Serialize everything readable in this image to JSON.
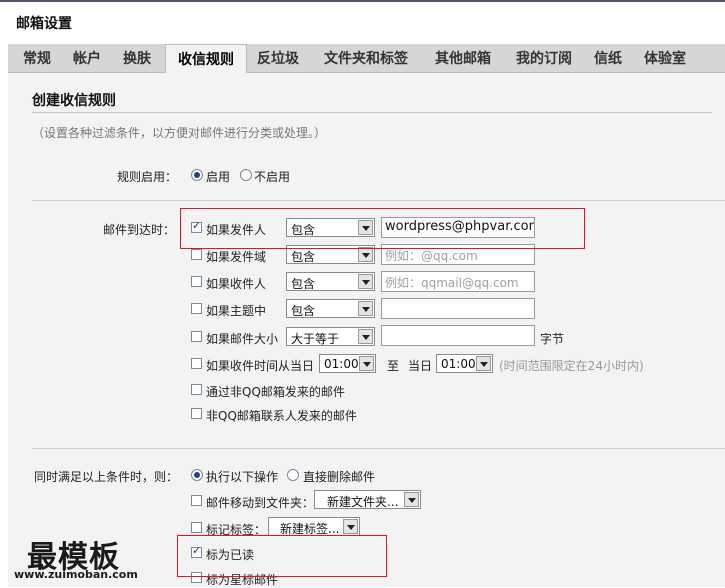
{
  "window": {
    "title": "邮箱设置"
  },
  "tabs": [
    "常规",
    "帐户",
    "换肤",
    "收信规则",
    "反垃圾",
    "文件夹和标签",
    "其他邮箱",
    "我的订阅",
    "信纸",
    "体验室"
  ],
  "active_tab": "收信规则",
  "section": {
    "title": "创建收信规则",
    "hint": "（设置各种过滤条件，以方便对邮件进行分类或处理。）"
  },
  "rule_enable": {
    "label": "规则启用：",
    "on_label": "启用",
    "off_label": "不启用",
    "selected": "启用"
  },
  "conditions": {
    "label": "邮件到达时：",
    "sender": {
      "label": "如果发件人",
      "checked": true,
      "op": "包含",
      "value": "wordpress@phpvar.com"
    },
    "sender_domain": {
      "label": "如果发件域",
      "checked": false,
      "op": "包含",
      "placeholder": "例如：@qq.com"
    },
    "recipient": {
      "label": "如果收件人",
      "checked": false,
      "op": "包含",
      "placeholder": "例如：qqmail@qq.com"
    },
    "subject": {
      "label": "如果主题中",
      "checked": false,
      "op": "包含",
      "value": ""
    },
    "size": {
      "label": "如果邮件大小",
      "checked": false,
      "op": "大于等于",
      "value": "",
      "unit": "字节"
    },
    "time": {
      "label": "如果收件时间从当日",
      "checked": false,
      "from": "01:00",
      "to_label": "至",
      "day_label": "当日",
      "to": "01:00",
      "note": "(时间范围限定在24小时内)"
    },
    "non_qq": {
      "label": "通过非QQ邮箱发来的邮件",
      "checked": false
    },
    "non_contact": {
      "label": "非QQ邮箱联系人发来的邮件",
      "checked": false
    }
  },
  "actions": {
    "label": "同时满足以上条件时，则：",
    "execute_label": "执行以下操作",
    "delete_label": "直接删除邮件",
    "selected": "执行以下操作",
    "move": {
      "label": "邮件移动到文件夹：",
      "checked": false,
      "value": "新建文件夹..."
    },
    "tag": {
      "label": "标记标签：",
      "checked": false,
      "value": "新建标签..."
    },
    "mark_read": {
      "label": "标为已读",
      "checked": true
    },
    "mark_star": {
      "label": "标为星标邮件",
      "checked": false
    }
  },
  "watermark": {
    "text": "最模板",
    "url": "www.zuimoban.com"
  },
  "colors": {
    "highlight_box": "#e0152a",
    "accent": "#1c3f94"
  }
}
